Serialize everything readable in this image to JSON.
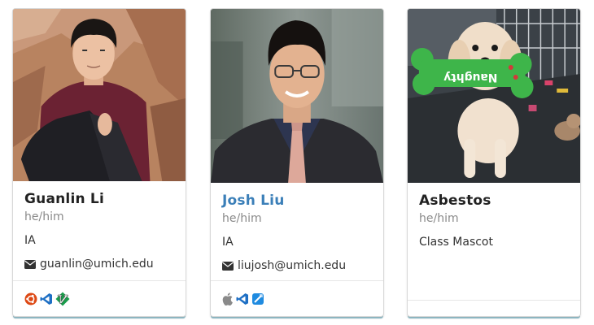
{
  "cards": [
    {
      "name": "Guanlin Li",
      "pronouns": "he/him",
      "role": "IA",
      "email": "guanlin@umich.edu",
      "tools": [
        "ubuntu-icon",
        "vscode-icon",
        "vim-icon"
      ]
    },
    {
      "name": "Josh Liu",
      "pronouns": "he/him",
      "role": "IA",
      "email": "liujosh@umich.edu",
      "tools": [
        "apple-icon",
        "vscode-icon",
        "xcode-icon"
      ]
    },
    {
      "name": "Asbestos",
      "pronouns": "he/him",
      "role": "Class Mascot",
      "toy_text": "Naughty"
    }
  ],
  "colors": {
    "link": "#3b7fb8",
    "accent_border": "#9ac6d2",
    "ubuntu": "#dd4814",
    "vscode": "#1e6fc4",
    "vim": "#199c4b"
  }
}
